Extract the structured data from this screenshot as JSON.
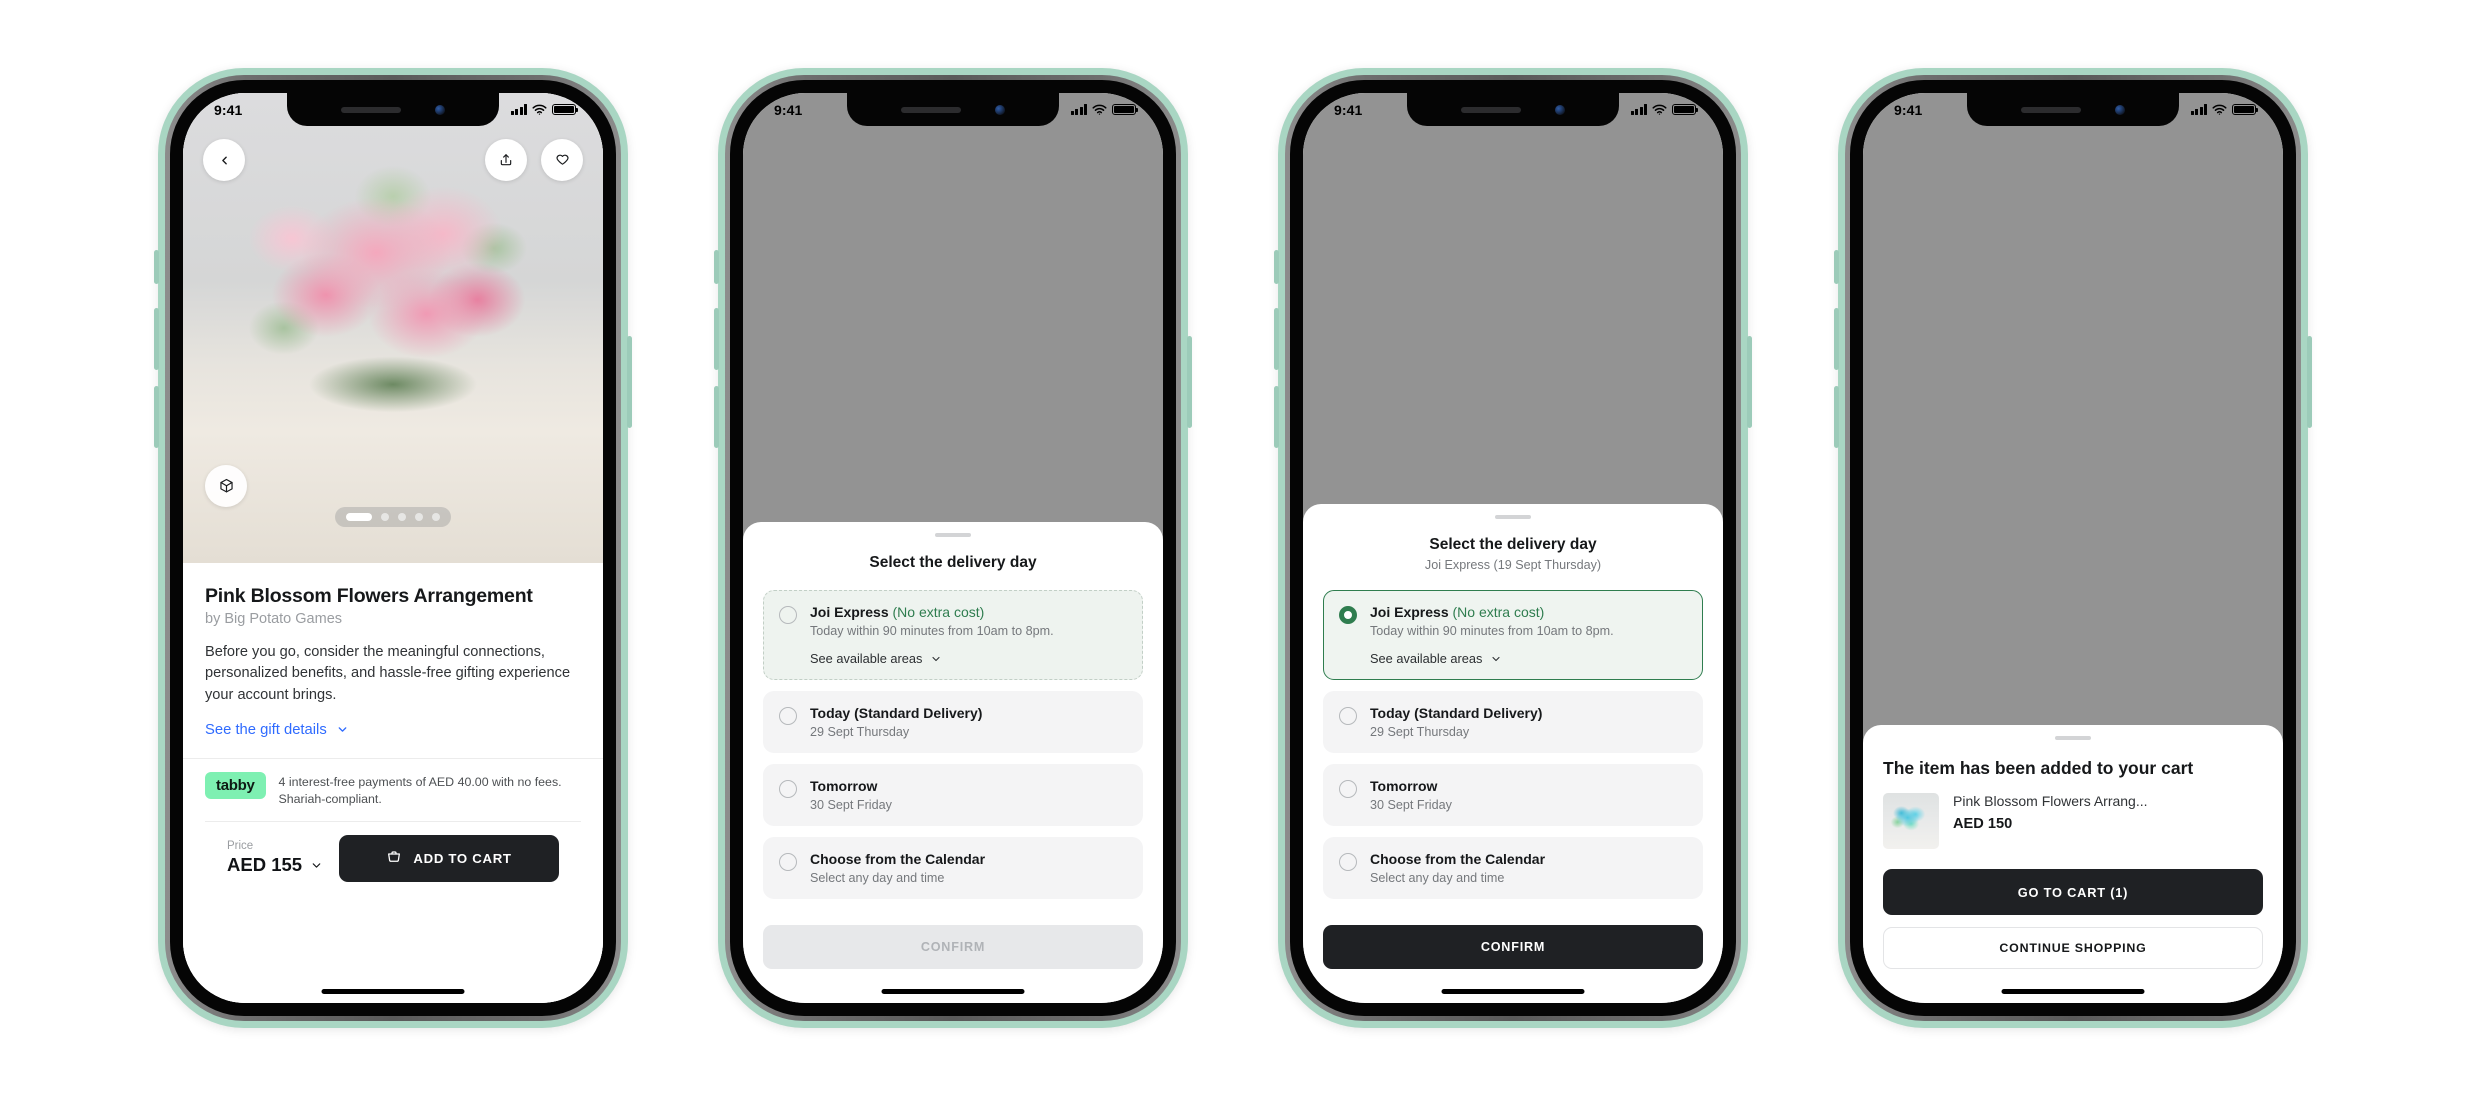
{
  "status_bar": {
    "time": "9:41",
    "signal_icon": "cellular-bars-icon",
    "wifi_icon": "wifi-icon",
    "battery_icon": "battery-icon"
  },
  "screen1": {
    "back_icon": "chevron-left-icon",
    "share_icon": "share-icon",
    "favorite_icon": "heart-icon",
    "ar_icon": "ar-3d-cube-icon",
    "carousel": {
      "total": 5,
      "active": 1
    },
    "product": {
      "title": "Pink Blossom Flowers Arrangement",
      "brand": "by Big Potato Games",
      "description": "Before you go, consider the meaningful connections, personalized benefits, and hassle-free gifting experience your account brings.",
      "details_link": "See the gift details",
      "details_chevron": "chevron-down-icon"
    },
    "tabby": {
      "logo_text": "tabby",
      "badge_color": "#7ef0b2",
      "message": "4 interest-free payments of AED 40.00 with no fees. Shariah-compliant."
    },
    "footer": {
      "price_label": "Price",
      "price_value": "AED 155",
      "price_chevron": "chevron-down-icon",
      "cart_icon": "shopping-cart-icon",
      "add_to_cart_label": "ADD TO CART"
    }
  },
  "screen2": {
    "title": "Select the delivery day",
    "subtitle": "",
    "options": [
      {
        "title": "Joi Express",
        "tag": "(No extra cost)",
        "subtitle": "Today within 90 minutes from 10am to 8pm.",
        "link": "See available areas",
        "link_chevron": "chevron-down-icon",
        "selected": false
      },
      {
        "title": "Today (Standard Delivery)",
        "tag": "",
        "subtitle": "29 Sept Thursday",
        "link": "",
        "selected": false
      },
      {
        "title": "Tomorrow",
        "tag": "",
        "subtitle": "30 Sept Friday",
        "link": "",
        "selected": false
      },
      {
        "title": "Choose from the Calendar",
        "tag": "",
        "subtitle": "Select any day and time",
        "link": "",
        "selected": false
      }
    ],
    "confirm_label": "CONFIRM",
    "confirm_enabled": false
  },
  "screen3": {
    "title": "Select the delivery day",
    "subtitle": "Joi Express (19 Sept Thursday)",
    "options": [
      {
        "title": "Joi Express",
        "tag": "(No extra cost)",
        "subtitle": "Today within 90 minutes from 10am to 8pm.",
        "link": "See available areas",
        "link_chevron": "chevron-down-icon",
        "selected": true
      },
      {
        "title": "Today (Standard Delivery)",
        "tag": "",
        "subtitle": "29 Sept Thursday",
        "link": "",
        "selected": false
      },
      {
        "title": "Tomorrow",
        "tag": "",
        "subtitle": "30 Sept Friday",
        "link": "",
        "selected": false
      },
      {
        "title": "Choose from the Calendar",
        "tag": "",
        "subtitle": "Select any day and time",
        "link": "",
        "selected": false
      }
    ],
    "confirm_label": "CONFIRM",
    "confirm_enabled": true
  },
  "screen4": {
    "title": "The item has been added to your cart",
    "item": {
      "name": "Pink Blossom Flowers Arrang...",
      "price": "AED 150",
      "thumbnail": "flower-bouquet-thumbnail"
    },
    "go_to_cart_label": "GO TO CART (1)",
    "continue_label": "CONTINUE SHOPPING"
  },
  "colors": {
    "accent_green": "#2f7d4f",
    "link_blue": "#2f6bff",
    "dark_button": "#1f2124",
    "frame_mint": "#a9d6c3"
  }
}
